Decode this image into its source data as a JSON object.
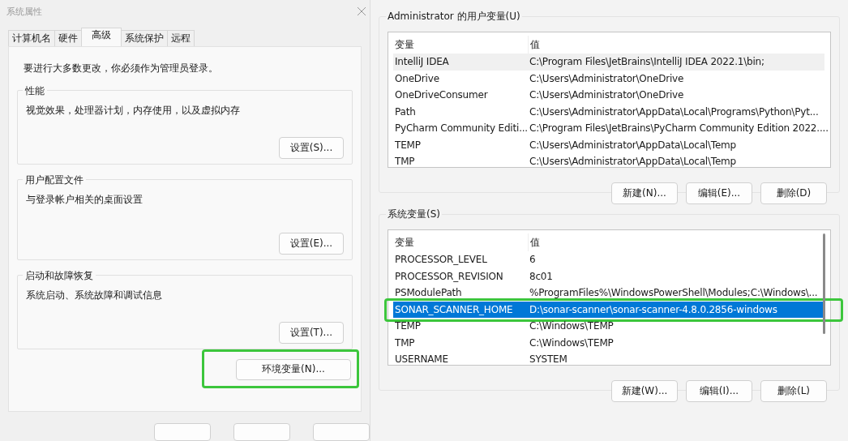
{
  "system_properties": {
    "title": "系统属性",
    "tabs": [
      {
        "label": "计算机名",
        "selected": false
      },
      {
        "label": "硬件",
        "selected": false
      },
      {
        "label": "高级",
        "selected": true
      },
      {
        "label": "系统保护",
        "selected": false
      },
      {
        "label": "远程",
        "selected": false
      }
    ],
    "notice": "要进行大多数更改，你必须作为管理员登录。",
    "groups": [
      {
        "title": "性能",
        "description": "视觉效果，处理器计划，内存使用，以及虚拟内存",
        "button": "设置(S)..."
      },
      {
        "title": "用户配置文件",
        "description": "与登录帐户相关的桌面设置",
        "button": "设置(E)..."
      },
      {
        "title": "启动和故障恢复",
        "description": "系统启动、系统故障和调试信息",
        "button": "设置(T)..."
      }
    ],
    "env_button": {
      "label": "环境变量(N)...",
      "annotated": true
    }
  },
  "environment_variables": {
    "lists": [
      {
        "title": "Administrator 的用户变量(U)",
        "active": false,
        "columns": [
          "变量",
          "值"
        ],
        "scrollbar": false,
        "rows": [
          {
            "name": "IntelliJ IDEA",
            "value": "C:\\Program Files\\JetBrains\\IntelliJ IDEA 2022.1\\bin;",
            "selected": true,
            "annotated": false
          },
          {
            "name": "OneDrive",
            "value": "C:\\Users\\Administrator\\OneDrive",
            "selected": false,
            "annotated": false
          },
          {
            "name": "OneDriveConsumer",
            "value": "C:\\Users\\Administrator\\OneDrive",
            "selected": false,
            "annotated": false
          },
          {
            "name": "Path",
            "value": "C:\\Users\\Administrator\\AppData\\Local\\Programs\\Python\\Pyt...",
            "selected": false,
            "annotated": false
          },
          {
            "name": "PyCharm Community Editi...",
            "value": "C:\\Program Files\\JetBrains\\PyCharm Community Edition 2022....",
            "selected": false,
            "annotated": false
          },
          {
            "name": "TEMP",
            "value": "C:\\Users\\Administrator\\AppData\\Local\\Temp",
            "selected": false,
            "annotated": false
          },
          {
            "name": "TMP",
            "value": "C:\\Users\\Administrator\\AppData\\Local\\Temp",
            "selected": false,
            "annotated": false
          }
        ],
        "buttons": [
          "新建(N)...",
          "编辑(E)...",
          "删除(D)"
        ]
      },
      {
        "title": "系统变量(S)",
        "active": true,
        "columns": [
          "变量",
          "值"
        ],
        "scrollbar": true,
        "rows": [
          {
            "name": "PROCESSOR_LEVEL",
            "value": "6",
            "selected": false,
            "annotated": false
          },
          {
            "name": "PROCESSOR_REVISION",
            "value": "8c01",
            "selected": false,
            "annotated": false
          },
          {
            "name": "PSModulePath",
            "value": "%ProgramFiles%\\WindowsPowerShell\\Modules;C:\\Windows\\...",
            "selected": false,
            "annotated": false
          },
          {
            "name": "SONAR_SCANNER_HOME",
            "value": "D:\\sonar-scanner\\sonar-scanner-4.8.0.2856-windows",
            "selected": true,
            "annotated": true
          },
          {
            "name": "TEMP",
            "value": "C:\\Windows\\TEMP",
            "selected": false,
            "annotated": false
          },
          {
            "name": "TMP",
            "value": "C:\\Windows\\TEMP",
            "selected": false,
            "annotated": false
          },
          {
            "name": "USERNAME",
            "value": "SYSTEM",
            "selected": false,
            "annotated": false
          }
        ],
        "buttons": [
          "新建(W)...",
          "编辑(I)...",
          "删除(L)"
        ]
      }
    ]
  }
}
